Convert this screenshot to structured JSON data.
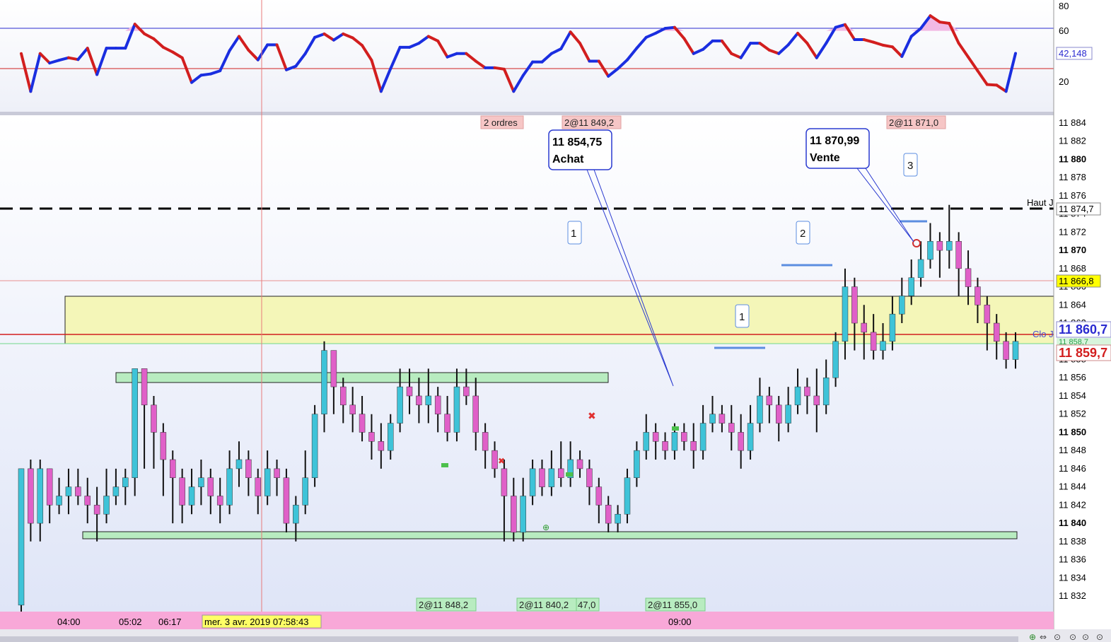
{
  "colors": {
    "bull": "#3ec3d8",
    "bear": "#e060c8",
    "wick": "#111111",
    "zone_yellow": "#f4f6b8",
    "zone_green": "#b8ecc0",
    "rsi_up": "#1a2ee0",
    "rsi_down": "#d21e1e",
    "axis_bg": "#ffffff",
    "time_bg": "#f8a8d8",
    "plot_bg_top": "#ffffff",
    "plot_bg_bottom": "#dfe5f7"
  },
  "rsi_panel": {
    "value_label": "42,148",
    "ticks": [
      "80",
      "60",
      "20"
    ]
  },
  "price_axis": {
    "ticks": [
      "11 884",
      "11 882",
      "11 880",
      "11 878",
      "11 876",
      "11 874",
      "11 872",
      "11 870",
      "11 868",
      "11 866",
      "11 864",
      "11 862",
      "11 860",
      "11 858",
      "11 856",
      "11 854",
      "11 852",
      "11 850",
      "11 848",
      "11 846",
      "11 844",
      "11 842",
      "11 840",
      "11 838",
      "11 836",
      "11 834",
      "11 832"
    ],
    "bold_ticks": [
      "11 880",
      "11 870",
      "11 860",
      "11 850",
      "11 840"
    ]
  },
  "price_tags": {
    "haut_label": "Haut J",
    "haut_value": "11 874,7",
    "level_value": "11 866,8",
    "clo_label": "Clo J",
    "last_blue": "11 860,7",
    "green_small": "11 858,7",
    "last_red": "11 859,7"
  },
  "orders_top": [
    {
      "text": "2 ordres"
    },
    {
      "text": "2@11 849,2"
    },
    {
      "text": "2@11 871,0"
    }
  ],
  "orders_bottom": [
    {
      "text": "2@11 848,2"
    },
    {
      "text": "2@11 840,2"
    },
    {
      "text": "47,0"
    },
    {
      "text": "2@11 855,0"
    }
  ],
  "callouts": [
    {
      "price": "11 854,75",
      "side": "Achat"
    },
    {
      "price": "11 870,99",
      "side": "Vente"
    }
  ],
  "counters": [
    "1",
    "2",
    "3",
    "1"
  ],
  "time_axis": {
    "labels": [
      "04:00",
      "05:02",
      "06:17",
      "09:00"
    ],
    "cursor_label": "mer. 3 avr. 2019 07:58:43"
  },
  "chart_data": {
    "type": "candlestick",
    "instrument_levels": {
      "haut_j": 11874.7,
      "clo_j": 11860.7,
      "level_866": 11866.8,
      "zone_yellow": [
        11858.7,
        11865.5
      ],
      "zone_green_top": [
        11856.0,
        11857.0
      ],
      "zone_green_bottom": [
        11838.5,
        11839.3
      ]
    },
    "ylim": [
      11831,
      11886
    ],
    "candles_ohlc": [
      [
        11831,
        11846,
        11830,
        11846
      ],
      [
        11846,
        11840,
        11838,
        11847
      ],
      [
        11840,
        11846,
        11838,
        11847
      ],
      [
        11846,
        11842,
        11840,
        11846
      ],
      [
        11842,
        11843,
        11841,
        11845
      ],
      [
        11843,
        11844,
        11841,
        11846
      ],
      [
        11844,
        11843,
        11842,
        11846
      ],
      [
        11843,
        11842,
        11840,
        11845
      ],
      [
        11842,
        11841,
        11838,
        11844
      ],
      [
        11841,
        11843,
        11840,
        11846
      ],
      [
        11843,
        11844,
        11842,
        11846
      ],
      [
        11844,
        11845,
        11842,
        11846
      ],
      [
        11845,
        11857,
        11843,
        11857
      ],
      [
        11857,
        11853,
        11846,
        11857
      ],
      [
        11853,
        11850,
        11846,
        11854
      ],
      [
        11850,
        11847,
        11843,
        11851
      ],
      [
        11847,
        11845,
        11840,
        11848
      ],
      [
        11845,
        11842,
        11840,
        11846
      ],
      [
        11842,
        11844,
        11841,
        11846
      ],
      [
        11844,
        11845,
        11842,
        11847
      ],
      [
        11845,
        11843,
        11841,
        11846
      ],
      [
        11843,
        11842,
        11840,
        11845
      ],
      [
        11842,
        11846,
        11841,
        11848
      ],
      [
        11846,
        11847,
        11844,
        11849
      ],
      [
        11847,
        11845,
        11843,
        11848
      ],
      [
        11845,
        11843,
        11841,
        11846
      ],
      [
        11843,
        11846,
        11842,
        11848
      ],
      [
        11846,
        11845,
        11843,
        11847
      ],
      [
        11845,
        11840,
        11839,
        11846
      ],
      [
        11840,
        11842,
        11838,
        11843
      ],
      [
        11842,
        11845,
        11841,
        11848
      ],
      [
        11845,
        11852,
        11844,
        11853
      ],
      [
        11852,
        11859,
        11850,
        11860
      ],
      [
        11859,
        11855,
        11852,
        11859
      ],
      [
        11855,
        11853,
        11851,
        11856
      ],
      [
        11853,
        11852,
        11850,
        11855
      ],
      [
        11852,
        11850,
        11849,
        11854
      ],
      [
        11850,
        11849,
        11847,
        11852
      ],
      [
        11849,
        11848,
        11846,
        11851
      ],
      [
        11848,
        11851,
        11847,
        11852
      ],
      [
        11851,
        11855,
        11850,
        11857
      ],
      [
        11855,
        11854,
        11852,
        11857
      ],
      [
        11854,
        11853,
        11851,
        11856
      ],
      [
        11853,
        11854,
        11851,
        11857
      ],
      [
        11854,
        11852,
        11850,
        11855
      ],
      [
        11852,
        11850,
        11849,
        11854
      ],
      [
        11850,
        11855,
        11849,
        11857
      ],
      [
        11855,
        11854,
        11853,
        11857
      ],
      [
        11854,
        11850,
        11848,
        11856
      ],
      [
        11850,
        11848,
        11846,
        11851
      ],
      [
        11848,
        11846,
        11845,
        11849
      ],
      [
        11846,
        11843,
        11838,
        11847
      ],
      [
        11843,
        11839,
        11838,
        11845
      ],
      [
        11839,
        11843,
        11838,
        11845
      ],
      [
        11843,
        11846,
        11842,
        11847
      ],
      [
        11846,
        11844,
        11843,
        11847
      ],
      [
        11844,
        11846,
        11843,
        11848
      ],
      [
        11846,
        11845,
        11844,
        11849
      ],
      [
        11845,
        11847,
        11844,
        11849
      ],
      [
        11847,
        11846,
        11845,
        11848
      ],
      [
        11846,
        11844,
        11842,
        11847
      ],
      [
        11844,
        11842,
        11840,
        11845
      ],
      [
        11842,
        11840,
        11839,
        11843
      ],
      [
        11840,
        11841,
        11839,
        11842
      ],
      [
        11841,
        11845,
        11840,
        11846
      ],
      [
        11845,
        11848,
        11844,
        11849
      ],
      [
        11848,
        11850,
        11847,
        11852
      ],
      [
        11850,
        11849,
        11847,
        11851
      ],
      [
        11849,
        11848,
        11847,
        11850
      ],
      [
        11848,
        11850,
        11847,
        11851
      ],
      [
        11850,
        11849,
        11848,
        11851
      ],
      [
        11849,
        11848,
        11846,
        11851
      ],
      [
        11848,
        11851,
        11847,
        11853
      ],
      [
        11851,
        11852,
        11850,
        11854
      ],
      [
        11852,
        11851,
        11850,
        11853
      ],
      [
        11851,
        11850,
        11848,
        11853
      ],
      [
        11850,
        11848,
        11846,
        11852
      ],
      [
        11848,
        11851,
        11847,
        11853
      ],
      [
        11851,
        11854,
        11850,
        11856
      ],
      [
        11854,
        11853,
        11851,
        11855
      ],
      [
        11853,
        11851,
        11849,
        11854
      ],
      [
        11851,
        11853,
        11850,
        11855
      ],
      [
        11853,
        11855,
        11852,
        11857
      ],
      [
        11855,
        11854,
        11852,
        11856
      ],
      [
        11854,
        11853,
        11850,
        11857
      ],
      [
        11853,
        11856,
        11852,
        11858
      ],
      [
        11856,
        11860,
        11855,
        11861
      ],
      [
        11860,
        11866,
        11858,
        11868
      ],
      [
        11866,
        11862,
        11859,
        11867
      ],
      [
        11862,
        11861,
        11858,
        11864
      ],
      [
        11861,
        11859,
        11858,
        11863
      ],
      [
        11859,
        11860,
        11858,
        11862
      ],
      [
        11860,
        11863,
        11859,
        11865
      ],
      [
        11863,
        11865,
        11862,
        11867
      ],
      [
        11865,
        11867,
        11864,
        11869
      ],
      [
        11867,
        11869,
        11866,
        11871
      ],
      [
        11869,
        11871,
        11868,
        11873
      ],
      [
        11871,
        11870,
        11867,
        11872
      ],
      [
        11870,
        11871,
        11868,
        11875
      ],
      [
        11871,
        11868,
        11865,
        11872
      ],
      [
        11868,
        11866,
        11864,
        11870
      ],
      [
        11866,
        11864,
        11862,
        11867
      ],
      [
        11864,
        11862,
        11859,
        11865
      ],
      [
        11862,
        11860,
        11858,
        11863
      ],
      [
        11860,
        11858,
        11857,
        11861
      ],
      [
        11858,
        11860,
        11857,
        11861
      ]
    ],
    "rsi": {
      "overbought": 60,
      "oversold": 30,
      "last": 42.148
    }
  }
}
